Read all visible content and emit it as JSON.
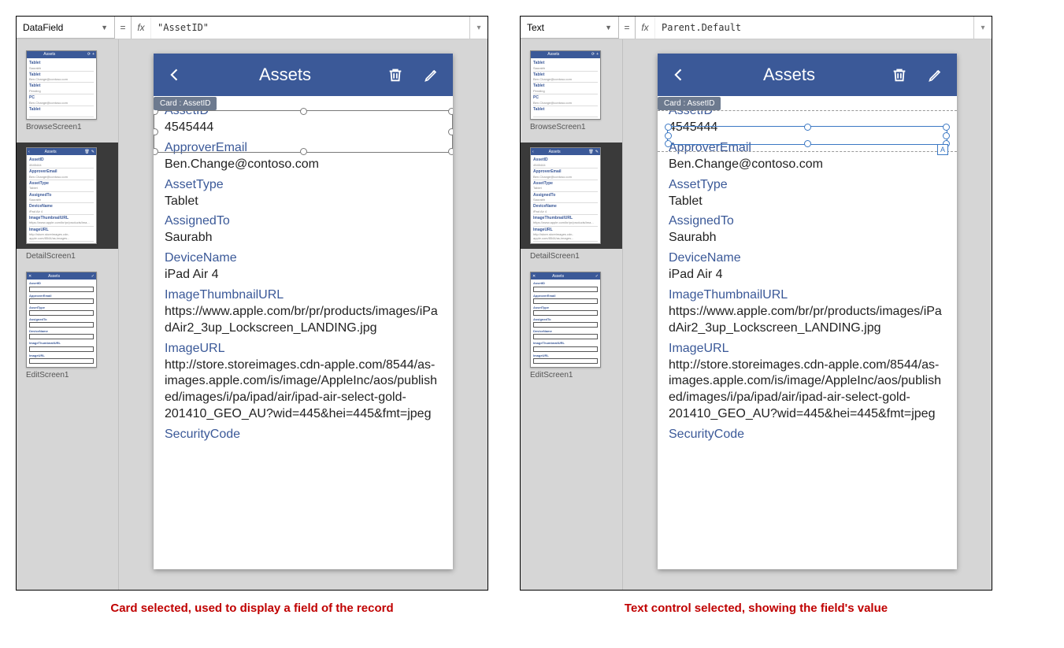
{
  "panel1": {
    "property": "DataField",
    "formula": "\"AssetID\"",
    "caption": "Card selected, used to display a field of the record"
  },
  "panel2": {
    "property": "Text",
    "formula": "Parent.Default",
    "caption": "Text control selected, showing the field's value"
  },
  "thumbs": {
    "browse": "BrowseScreen1",
    "detail": "DetailScreen1",
    "edit": "EditScreen1"
  },
  "app": {
    "title": "Assets",
    "cardTag": "Card : AssetID"
  },
  "fields": [
    {
      "label": "AssetID",
      "value": "4545444"
    },
    {
      "label": "ApproverEmail",
      "value": "Ben.Change@contoso.com"
    },
    {
      "label": "AssetType",
      "value": "Tablet"
    },
    {
      "label": "AssignedTo",
      "value": "Saurabh"
    },
    {
      "label": "DeviceName",
      "value": "iPad Air 4"
    },
    {
      "label": "ImageThumbnailURL",
      "value": "https://www.apple.com/br/pr/products/images/iPadAir2_3up_Lockscreen_LANDING.jpg"
    },
    {
      "label": "ImageURL",
      "value": "http://store.storeimages.cdn-apple.com/8544/as-images.apple.com/is/image/AppleInc/aos/published/images/i/pa/ipad/air/ipad-air-select-gold-201410_GEO_AU?wid=445&hei=445&fmt=jpeg"
    },
    {
      "label": "SecurityCode",
      "value": ""
    }
  ],
  "eq": "=",
  "fx": "fx",
  "aBadge": "A"
}
